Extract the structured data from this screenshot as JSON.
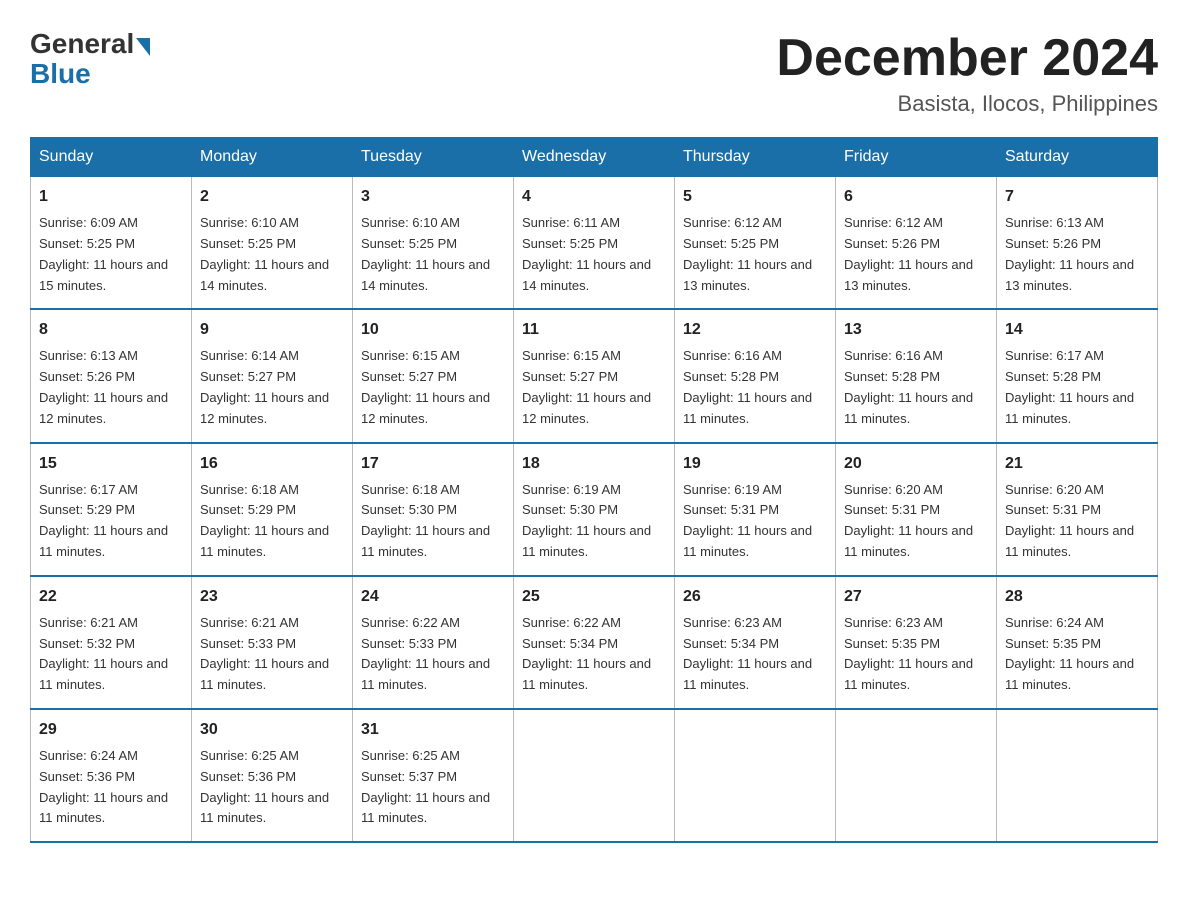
{
  "header": {
    "logo_general": "General",
    "logo_blue": "Blue",
    "month_year": "December 2024",
    "location": "Basista, Ilocos, Philippines"
  },
  "days_of_week": [
    "Sunday",
    "Monday",
    "Tuesday",
    "Wednesday",
    "Thursday",
    "Friday",
    "Saturday"
  ],
  "weeks": [
    [
      {
        "num": "1",
        "sunrise": "6:09 AM",
        "sunset": "5:25 PM",
        "daylight": "11 hours and 15 minutes."
      },
      {
        "num": "2",
        "sunrise": "6:10 AM",
        "sunset": "5:25 PM",
        "daylight": "11 hours and 14 minutes."
      },
      {
        "num": "3",
        "sunrise": "6:10 AM",
        "sunset": "5:25 PM",
        "daylight": "11 hours and 14 minutes."
      },
      {
        "num": "4",
        "sunrise": "6:11 AM",
        "sunset": "5:25 PM",
        "daylight": "11 hours and 14 minutes."
      },
      {
        "num": "5",
        "sunrise": "6:12 AM",
        "sunset": "5:25 PM",
        "daylight": "11 hours and 13 minutes."
      },
      {
        "num": "6",
        "sunrise": "6:12 AM",
        "sunset": "5:26 PM",
        "daylight": "11 hours and 13 minutes."
      },
      {
        "num": "7",
        "sunrise": "6:13 AM",
        "sunset": "5:26 PM",
        "daylight": "11 hours and 13 minutes."
      }
    ],
    [
      {
        "num": "8",
        "sunrise": "6:13 AM",
        "sunset": "5:26 PM",
        "daylight": "11 hours and 12 minutes."
      },
      {
        "num": "9",
        "sunrise": "6:14 AM",
        "sunset": "5:27 PM",
        "daylight": "11 hours and 12 minutes."
      },
      {
        "num": "10",
        "sunrise": "6:15 AM",
        "sunset": "5:27 PM",
        "daylight": "11 hours and 12 minutes."
      },
      {
        "num": "11",
        "sunrise": "6:15 AM",
        "sunset": "5:27 PM",
        "daylight": "11 hours and 12 minutes."
      },
      {
        "num": "12",
        "sunrise": "6:16 AM",
        "sunset": "5:28 PM",
        "daylight": "11 hours and 11 minutes."
      },
      {
        "num": "13",
        "sunrise": "6:16 AM",
        "sunset": "5:28 PM",
        "daylight": "11 hours and 11 minutes."
      },
      {
        "num": "14",
        "sunrise": "6:17 AM",
        "sunset": "5:28 PM",
        "daylight": "11 hours and 11 minutes."
      }
    ],
    [
      {
        "num": "15",
        "sunrise": "6:17 AM",
        "sunset": "5:29 PM",
        "daylight": "11 hours and 11 minutes."
      },
      {
        "num": "16",
        "sunrise": "6:18 AM",
        "sunset": "5:29 PM",
        "daylight": "11 hours and 11 minutes."
      },
      {
        "num": "17",
        "sunrise": "6:18 AM",
        "sunset": "5:30 PM",
        "daylight": "11 hours and 11 minutes."
      },
      {
        "num": "18",
        "sunrise": "6:19 AM",
        "sunset": "5:30 PM",
        "daylight": "11 hours and 11 minutes."
      },
      {
        "num": "19",
        "sunrise": "6:19 AM",
        "sunset": "5:31 PM",
        "daylight": "11 hours and 11 minutes."
      },
      {
        "num": "20",
        "sunrise": "6:20 AM",
        "sunset": "5:31 PM",
        "daylight": "11 hours and 11 minutes."
      },
      {
        "num": "21",
        "sunrise": "6:20 AM",
        "sunset": "5:31 PM",
        "daylight": "11 hours and 11 minutes."
      }
    ],
    [
      {
        "num": "22",
        "sunrise": "6:21 AM",
        "sunset": "5:32 PM",
        "daylight": "11 hours and 11 minutes."
      },
      {
        "num": "23",
        "sunrise": "6:21 AM",
        "sunset": "5:33 PM",
        "daylight": "11 hours and 11 minutes."
      },
      {
        "num": "24",
        "sunrise": "6:22 AM",
        "sunset": "5:33 PM",
        "daylight": "11 hours and 11 minutes."
      },
      {
        "num": "25",
        "sunrise": "6:22 AM",
        "sunset": "5:34 PM",
        "daylight": "11 hours and 11 minutes."
      },
      {
        "num": "26",
        "sunrise": "6:23 AM",
        "sunset": "5:34 PM",
        "daylight": "11 hours and 11 minutes."
      },
      {
        "num": "27",
        "sunrise": "6:23 AM",
        "sunset": "5:35 PM",
        "daylight": "11 hours and 11 minutes."
      },
      {
        "num": "28",
        "sunrise": "6:24 AM",
        "sunset": "5:35 PM",
        "daylight": "11 hours and 11 minutes."
      }
    ],
    [
      {
        "num": "29",
        "sunrise": "6:24 AM",
        "sunset": "5:36 PM",
        "daylight": "11 hours and 11 minutes."
      },
      {
        "num": "30",
        "sunrise": "6:25 AM",
        "sunset": "5:36 PM",
        "daylight": "11 hours and 11 minutes."
      },
      {
        "num": "31",
        "sunrise": "6:25 AM",
        "sunset": "5:37 PM",
        "daylight": "11 hours and 11 minutes."
      },
      {
        "num": "",
        "sunrise": "",
        "sunset": "",
        "daylight": ""
      },
      {
        "num": "",
        "sunrise": "",
        "sunset": "",
        "daylight": ""
      },
      {
        "num": "",
        "sunrise": "",
        "sunset": "",
        "daylight": ""
      },
      {
        "num": "",
        "sunrise": "",
        "sunset": "",
        "daylight": ""
      }
    ]
  ]
}
